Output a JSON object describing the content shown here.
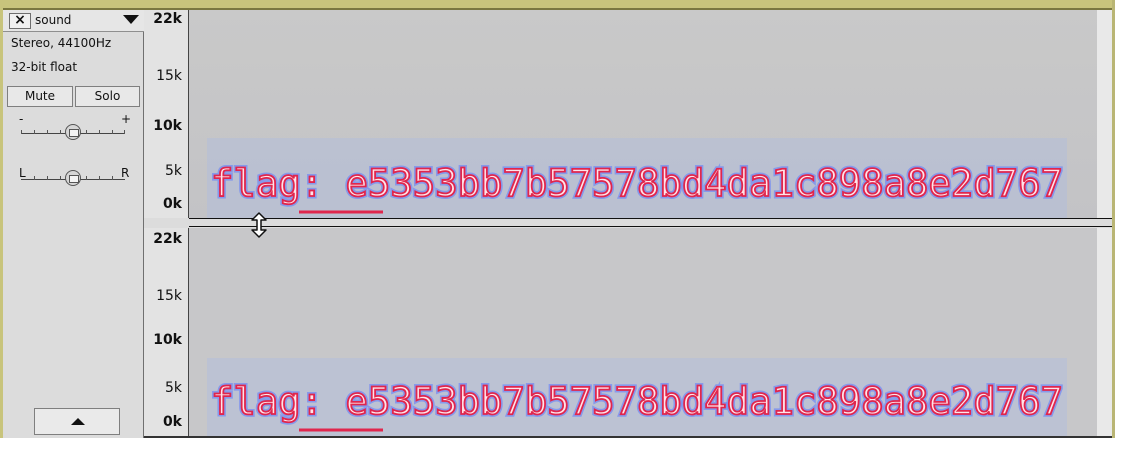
{
  "track": {
    "name": "sound",
    "format": "Stereo, 44100Hz",
    "bit_depth": "32-bit float",
    "mute_label": "Mute",
    "solo_label": "Solo",
    "gain_minus": "-",
    "gain_plus": "+",
    "pan_left": "L",
    "pan_right": "R",
    "gain_value": 0.5,
    "pan_value": 0.5
  },
  "ruler": {
    "top": "22k",
    "t15": "15k",
    "t10": "10k",
    "t5": "5k",
    "bottom": "0k"
  },
  "spectrogram": {
    "text": "flag: e5353bb7b57578bd4da1c898a8e2d767"
  },
  "icons": {
    "close": "close-icon",
    "menu": "chevron-down-icon",
    "collapse": "collapse-up-icon",
    "resize": "resize-vertical-icon"
  }
}
